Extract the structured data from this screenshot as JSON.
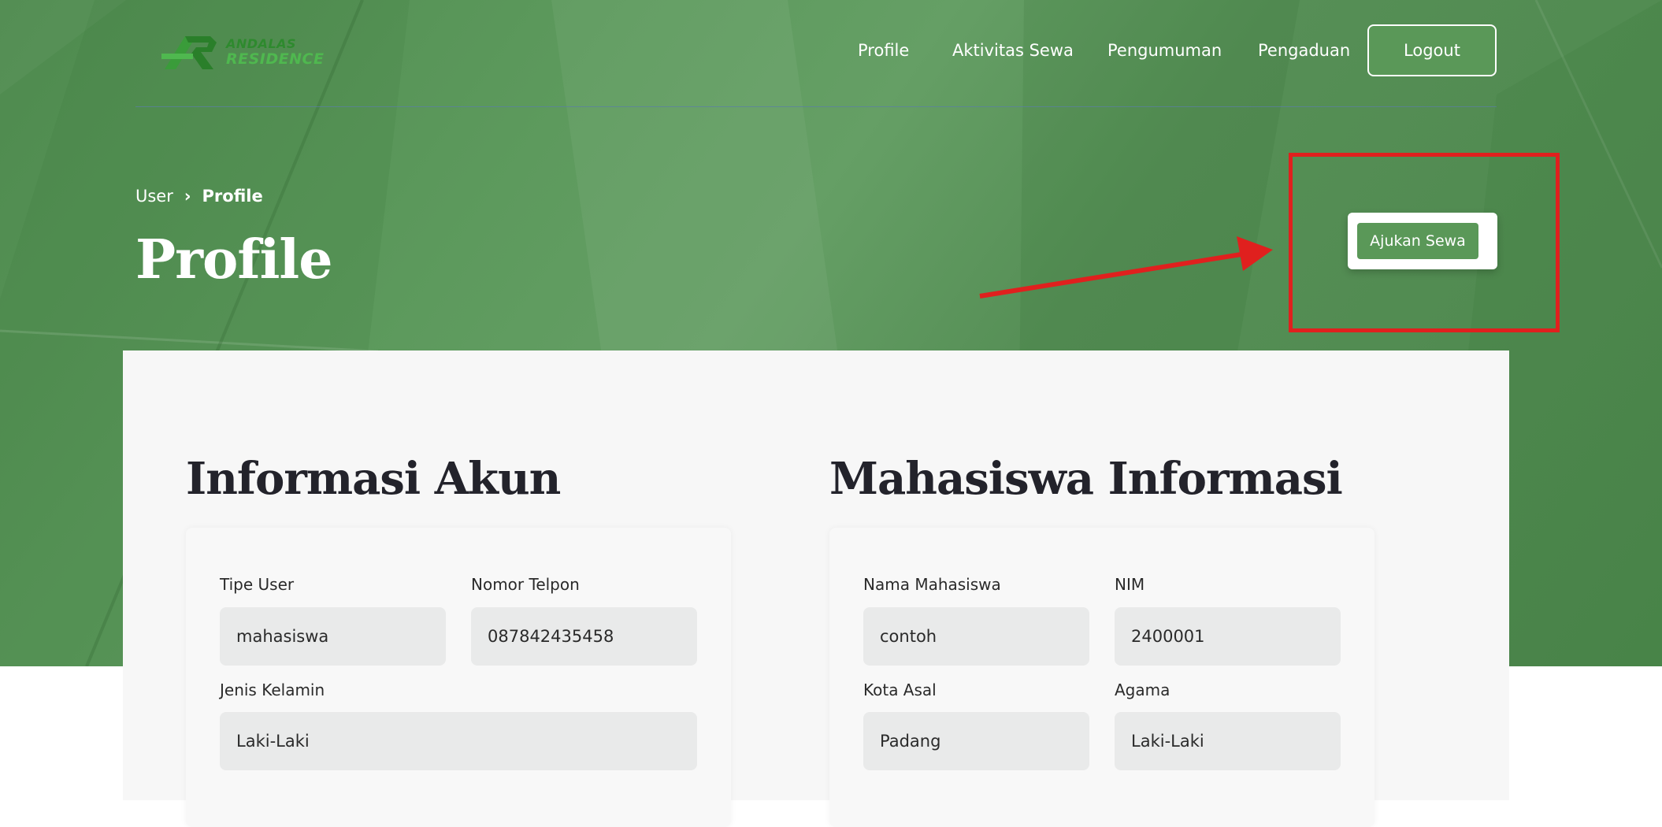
{
  "brand": {
    "line1": "ANDALAS",
    "line2": "RESIDENCE"
  },
  "nav": {
    "items": [
      "Profile",
      "Aktivitas Sewa",
      "Pengumuman",
      "Pengaduan"
    ],
    "logout": "Logout"
  },
  "breadcrumb": {
    "parent": "User",
    "current": "Profile"
  },
  "page": {
    "title": "Profile"
  },
  "cta": {
    "label": "Ajukan Sewa"
  },
  "annotation": {
    "color": "#e0201e"
  },
  "colors": {
    "accent": "#5a9858",
    "hero": "#5d9a5d"
  },
  "account": {
    "title": "Informasi Akun",
    "fields": [
      {
        "label": "Tipe User",
        "value": "mahasiswa"
      },
      {
        "label": "Nomor Telpon",
        "value": "087842435458"
      },
      {
        "label": "Jenis Kelamin",
        "value": "Laki-Laki"
      }
    ]
  },
  "student": {
    "title": "Mahasiswa Informasi",
    "fields": [
      {
        "label": "Nama Mahasiswa",
        "value": "contoh"
      },
      {
        "label": "NIM",
        "value": "2400001"
      },
      {
        "label": "Kota Asal",
        "value": "Padang"
      },
      {
        "label": "Agama",
        "value": "Laki-Laki"
      }
    ]
  }
}
